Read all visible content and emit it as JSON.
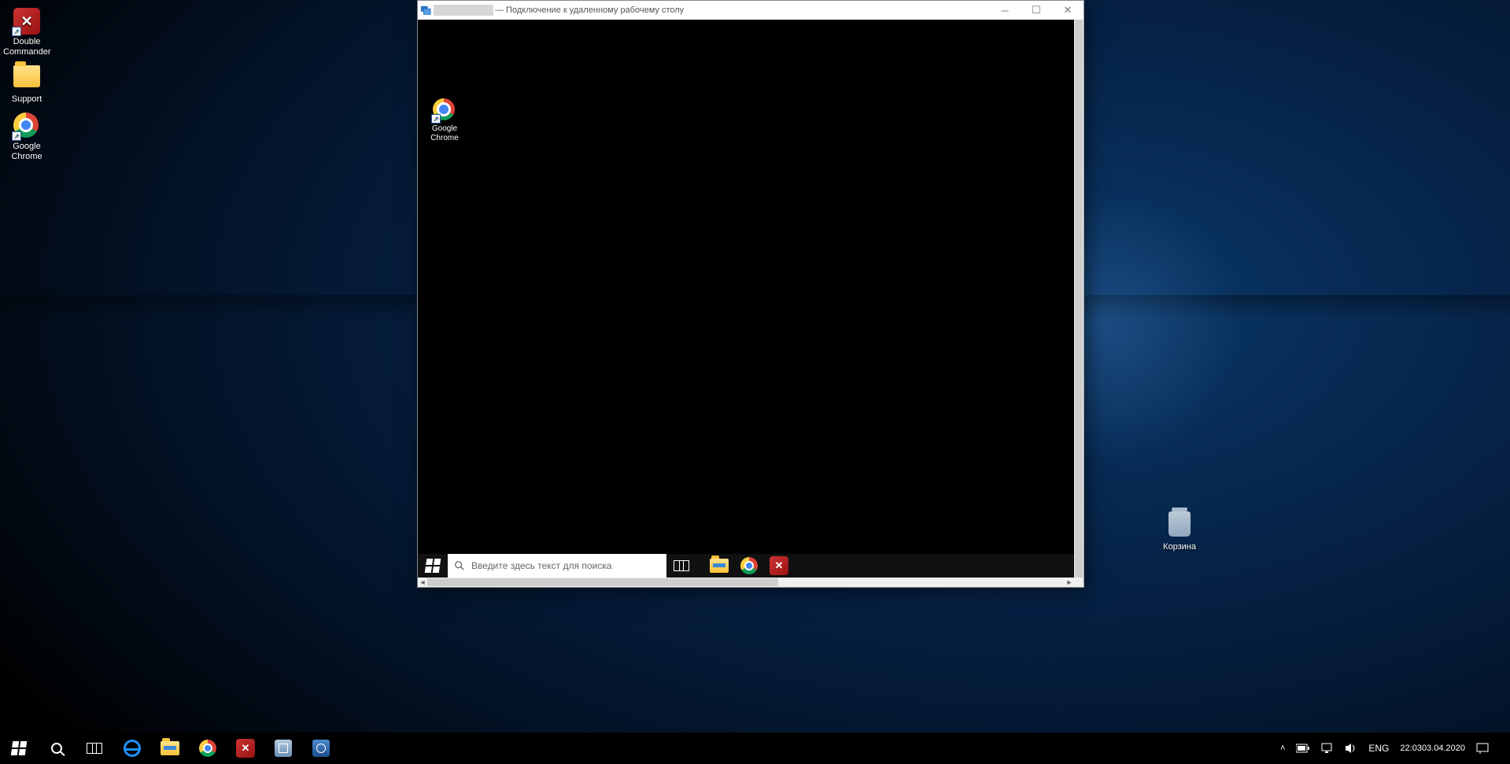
{
  "host_desktop": {
    "icons": [
      {
        "name": "double-commander",
        "label": "Double\nCommander",
        "kind": "dc",
        "shortcut": true
      },
      {
        "name": "support-folder",
        "label": "Support",
        "kind": "folder",
        "shortcut": false
      },
      {
        "name": "google-chrome",
        "label": "Google\nChrome",
        "kind": "chrome",
        "shortcut": true
      }
    ],
    "recycle_bin_label": "Корзина"
  },
  "rdp_window": {
    "title_suffix": "— Подключение к удаленному рабочему столу",
    "guest_desktop_icon_label": "Google\nChrome",
    "guest_search_placeholder": "Введите здесь текст для поиска"
  },
  "host_taskbar": {
    "tray": {
      "lang": "ENG",
      "time": "22:03",
      "date": "03.04.2020"
    }
  }
}
